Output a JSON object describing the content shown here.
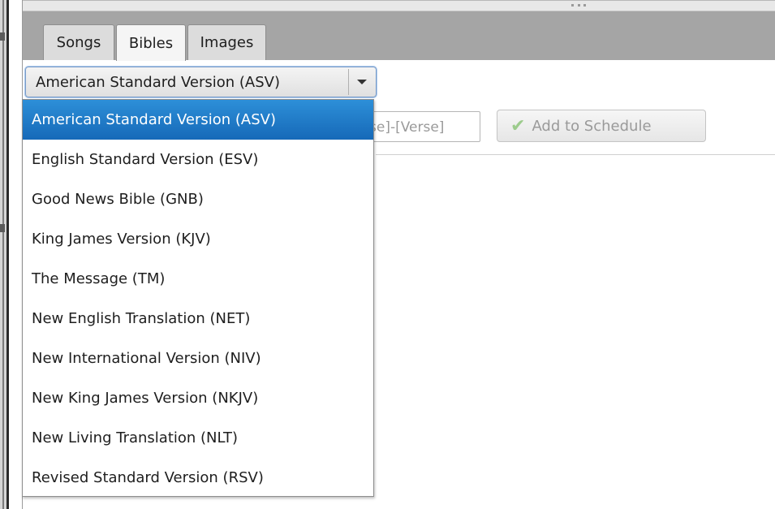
{
  "tabs": [
    {
      "label": "Songs"
    },
    {
      "label": "Bibles"
    },
    {
      "label": "Images"
    }
  ],
  "active_tab": "Bibles",
  "bible_select": {
    "selected": "American Standard Version (ASV)",
    "options": [
      "American Standard Version (ASV)",
      "English Standard Version (ESV)",
      "Good News Bible (GNB)",
      "King James Version (KJV)",
      "The Message (TM)",
      "New English Translation (NET)",
      "New International Version (NIV)",
      "New King James Version (NKJV)",
      "New Living Translation (NLT)",
      "Revised Standard Version (RSV)"
    ]
  },
  "reference_input": {
    "visible_placeholder": "se]-[Verse]"
  },
  "add_button": {
    "label": "Add to Schedule",
    "icon": "checkmark-icon",
    "enabled": false
  },
  "colors": {
    "tab_bar": "#a5a5a5",
    "selection": "#1f7ccb",
    "checkmark": "#9ccb8c"
  }
}
